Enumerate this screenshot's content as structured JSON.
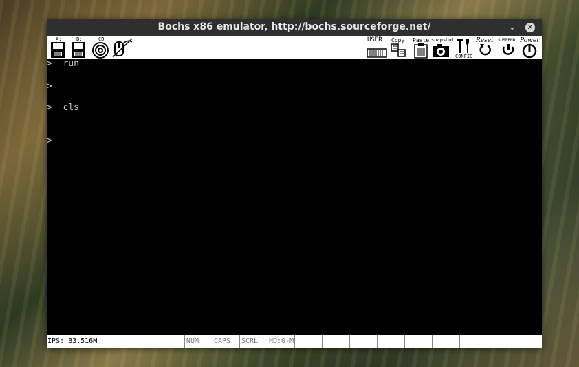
{
  "window": {
    "title": "Bochs x86 emulator, http://bochs.sourceforge.net/",
    "minimize_icon": "chevron-down-icon",
    "close_icon": "close-icon"
  },
  "toolbar": {
    "floppy_a_label": "A:",
    "floppy_b_label": "B:",
    "cdrom_label": "CD",
    "user_label": "USER",
    "copy_label": "Copy",
    "paste_label": "Paste",
    "snapshot_label": "snapshot",
    "config_label": "CONFIG",
    "reset_label": "Reset",
    "suspend_label": "SUSPEND",
    "power_label": "Power"
  },
  "terminal": {
    "lines": [
      {
        "prompt": ">",
        "command": "run"
      },
      {
        "prompt": ">",
        "command": ""
      },
      {
        "prompt": ">",
        "command": "cls"
      },
      {
        "prompt": ">",
        "command": ""
      }
    ]
  },
  "statusbar": {
    "ips": "IPS: 83.516M",
    "num": "NUM",
    "caps": "CAPS",
    "scrl": "SCRL",
    "hd": "HD:0-M"
  },
  "colors": {
    "titlebar": "#2f2f2f",
    "screen_bg": "#000000",
    "screen_text": "#c8c8c8"
  }
}
